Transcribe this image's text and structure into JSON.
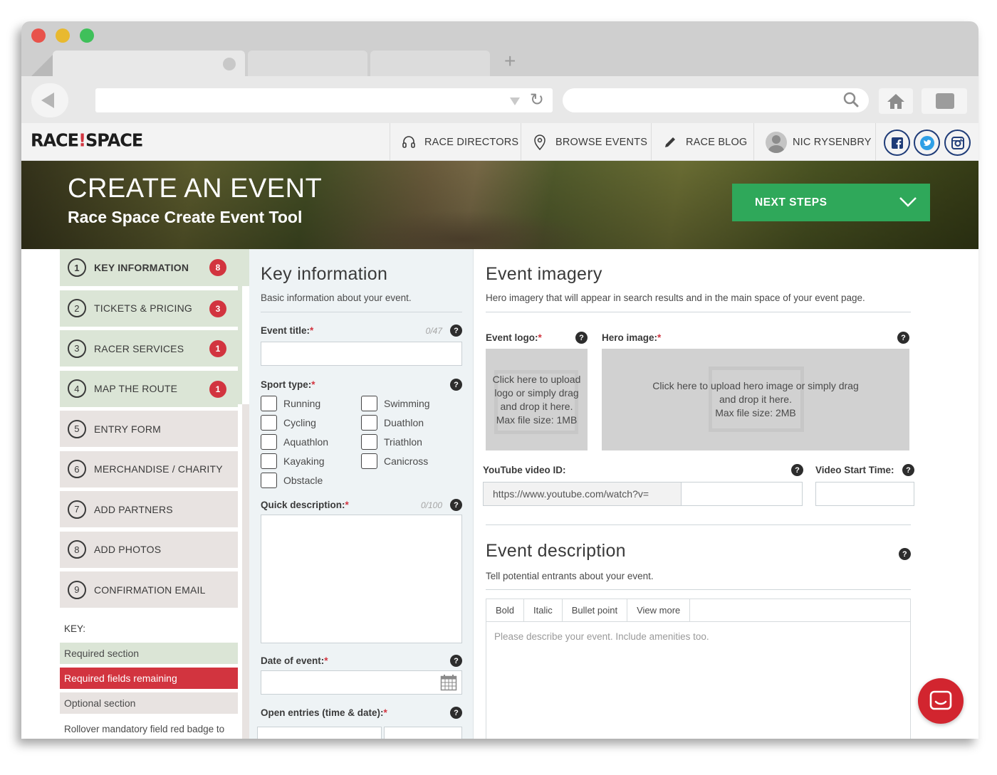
{
  "browser": {
    "colors": {
      "close": "#e8534b",
      "minimize": "#e8b92f",
      "maximize": "#3fc05a"
    },
    "new_tab": "+"
  },
  "site": {
    "logo": {
      "part1": "RACE",
      "part2": "SPACE"
    },
    "nav": {
      "race_directors": "RACE DIRECTORS",
      "browse_events": "BROWSE EVENTS",
      "race_blog": "RACE BLOG",
      "user": "NIC RYSENBRY"
    },
    "social": [
      "facebook-icon",
      "twitter-icon",
      "instagram-icon"
    ],
    "brand_colors": {
      "accent_red": "#d2343f",
      "green": "#2fa85a",
      "social_blue": "#1f3c78"
    }
  },
  "hero": {
    "title": "CREATE AN EVENT",
    "subtitle": "Race Space Create Event Tool",
    "next_steps": "NEXT STEPS"
  },
  "sidebar": {
    "steps": [
      {
        "num": "1",
        "label": "KEY INFORMATION",
        "badge": "8"
      },
      {
        "num": "2",
        "label": "TICKETS & PRICING",
        "badge": "3"
      },
      {
        "num": "3",
        "label": "RACER SERVICES",
        "badge": "1"
      },
      {
        "num": "4",
        "label": "MAP THE ROUTE",
        "badge": "1"
      },
      {
        "num": "5",
        "label": "ENTRY FORM"
      },
      {
        "num": "6",
        "label": "MERCHANDISE / CHARITY"
      },
      {
        "num": "7",
        "label": "ADD PARTNERS"
      },
      {
        "num": "8",
        "label": "ADD PHOTOS"
      },
      {
        "num": "9",
        "label": "CONFIRMATION EMAIL"
      }
    ],
    "key_label": "KEY:",
    "key_required": "Required section",
    "key_remaining": "Required fields remaining",
    "key_optional": "Optional section",
    "key_note": "Rollover mandatory field red badge to see what is outstanding"
  },
  "key_info": {
    "title": "Key information",
    "desc": "Basic information about your event.",
    "event_title_label": "Event title:",
    "event_title_counter": "0/47",
    "sport_type_label": "Sport type:",
    "sports": [
      "Running",
      "Swimming",
      "Cycling",
      "Duathlon",
      "Aquathlon",
      "Triathlon",
      "Kayaking",
      "Canicross",
      "Obstacle"
    ],
    "quick_desc_label": "Quick description:",
    "quick_desc_counter": "0/100",
    "date_label": "Date of event:",
    "open_entries_label": "Open entries (time & date):",
    "required_star": "*",
    "help": "?"
  },
  "imagery": {
    "title": "Event imagery",
    "desc": "Hero imagery that will appear in search results and in the main space of your event page.",
    "logo_label": "Event logo:",
    "logo_upload": "Click here to upload logo or simply drag and drop it here. Max file size: 1MB",
    "hero_label": "Hero image:",
    "hero_upload_line1": "Click here to upload hero image or simply drag",
    "hero_upload_line2": "and drop it here.",
    "hero_upload_line3": "Max file size: 2MB",
    "youtube_label": "YouTube video ID:",
    "youtube_prefix": "https://www.youtube.com/watch?v=",
    "video_start_label": "Video Start Time:"
  },
  "description": {
    "title": "Event description",
    "desc": "Tell potential entrants about your event.",
    "toolbar": [
      "Bold",
      "Italic",
      "Bullet point",
      "View more"
    ],
    "placeholder": "Please describe your event. Include amenities too."
  }
}
